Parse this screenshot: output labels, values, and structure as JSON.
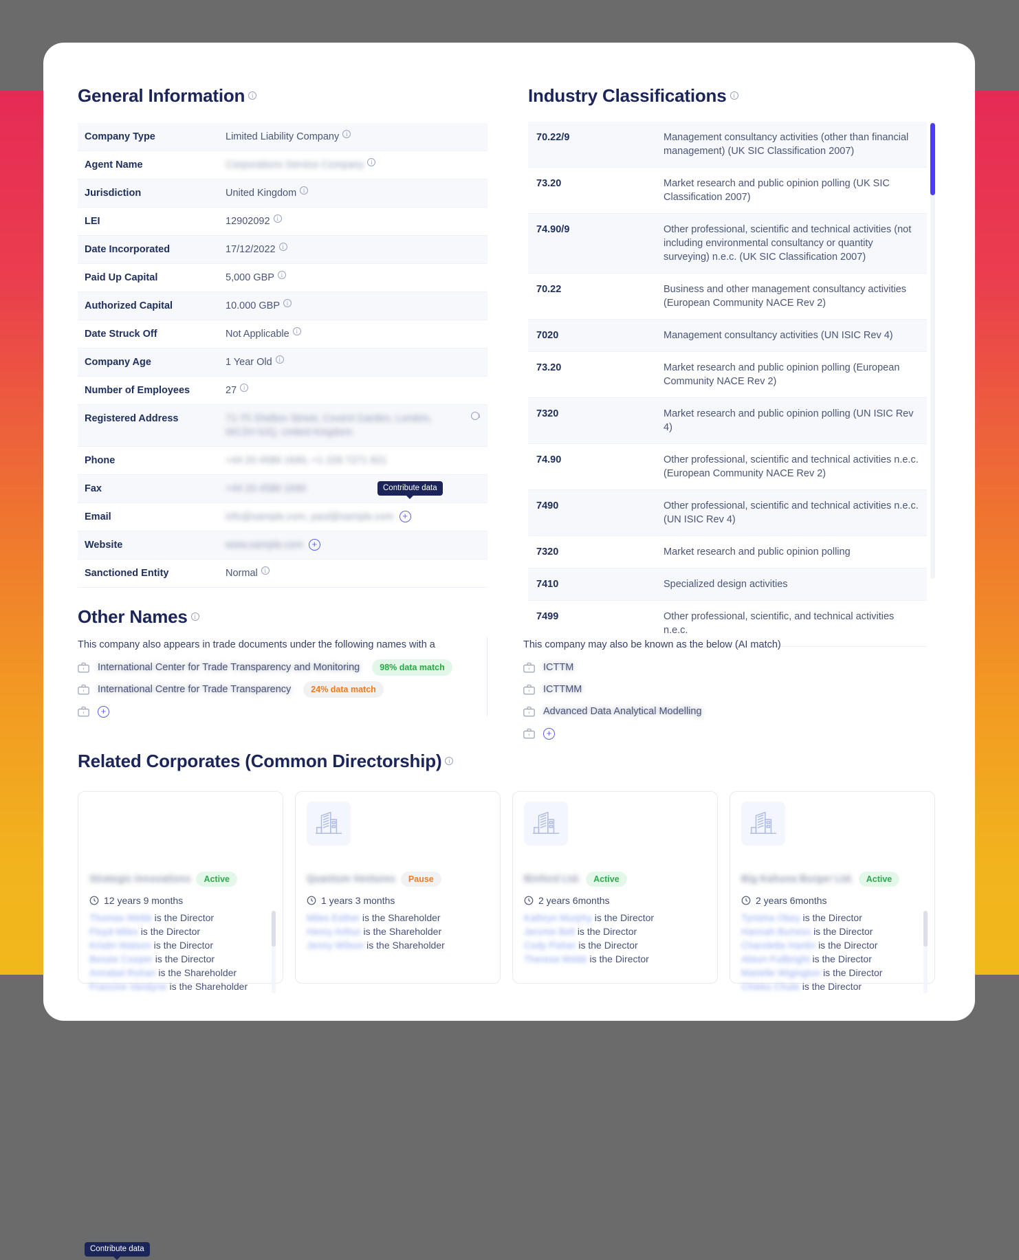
{
  "theme": {
    "accent": "#4b3df3",
    "title_color": "#1b2559",
    "gradient_top": "#e62a56",
    "gradient_bottom": "#f1b81c",
    "badge_green": "#28a745",
    "badge_orange": "#ec7a1c"
  },
  "general_information": {
    "title": "General Information",
    "rows": [
      {
        "label": "Company Type",
        "value": "Limited Liability Company",
        "redacted": false,
        "has_info": true
      },
      {
        "label": "Agent Name",
        "value": "Corporations Service Company",
        "redacted": true,
        "has_info": true
      },
      {
        "label": "Jurisdiction",
        "value": "United Kingdom",
        "redacted": false,
        "has_info": true
      },
      {
        "label": "LEI",
        "value": "12902092",
        "redacted": false,
        "has_info": true
      },
      {
        "label": "Date Incorporated",
        "value": "17/12/2022",
        "redacted": false,
        "has_info": true
      },
      {
        "label": "Paid Up Capital",
        "value": "5,000 GBP",
        "redacted": false,
        "has_info": true
      },
      {
        "label": "Authorized Capital",
        "value": "10.000 GBP",
        "redacted": false,
        "has_info": true
      },
      {
        "label": "Date Struck Off",
        "value": "Not Applicable",
        "redacted": false,
        "has_info": true
      },
      {
        "label": "Company Age",
        "value": "1 Year Old",
        "redacted": false,
        "has_info": true
      },
      {
        "label": "Number of Employees",
        "value": "27",
        "redacted": false,
        "has_info": true
      },
      {
        "label": "Registered Address",
        "value": "71-75 Shelton Street, Covent Garden, London, WC2H 9JQ, United Kingdom",
        "redacted": true,
        "has_info": true
      },
      {
        "label": "Phone",
        "value": "+44 20 4586 1690, +1 228 7271 821",
        "redacted": true,
        "has_info": false
      },
      {
        "label": "Fax",
        "value": "+44 20 4586 1690",
        "redacted": true,
        "has_info": false
      },
      {
        "label": "Email",
        "value": "info@sample.com, paul@sample.com",
        "redacted": true,
        "has_info": false,
        "has_plus": true
      },
      {
        "label": "Website",
        "value": "www.sample.com",
        "redacted": true,
        "has_info": false,
        "has_plus": true
      },
      {
        "label": "Sanctioned Entity",
        "value": "Normal",
        "redacted": false,
        "has_info": true
      }
    ]
  },
  "tooltips": {
    "contribute": "Contribute data"
  },
  "industry_classifications": {
    "title": "Industry Classifications",
    "rows": [
      {
        "code": "70.22/9",
        "description": "Management consultancy activities (other than financial management) (UK SIC Classification 2007)"
      },
      {
        "code": "73.20",
        "description": "Market research and public opinion polling (UK SIC Classification 2007)"
      },
      {
        "code": "74.90/9",
        "description": "Other professional, scientific and technical activities (not including environmental consultancy or quantity surveying) n.e.c. (UK SIC Classification 2007)"
      },
      {
        "code": "70.22",
        "description": "Business and other management consultancy activities (European Community NACE Rev 2)"
      },
      {
        "code": "7020",
        "description": "Management consultancy activities (UN ISIC Rev 4)"
      },
      {
        "code": "73.20",
        "description": "Market research and public opinion polling (European Community NACE Rev 2)"
      },
      {
        "code": "7320",
        "description": "Market research and public opinion polling (UN ISIC Rev 4)"
      },
      {
        "code": "74.90",
        "description": "Other professional, scientific and technical activities n.e.c. (European Community NACE Rev 2)"
      },
      {
        "code": "7490",
        "description": "Other professional, scientific and technical activities n.e.c. (UN ISIC Rev 4)"
      },
      {
        "code": "7320",
        "description": "Market research and public opinion polling"
      },
      {
        "code": "7410",
        "description": "Specialized design activities"
      },
      {
        "code": "7499",
        "description": "Other professional, scientific, and technical activities n.e.c."
      }
    ]
  },
  "other_names": {
    "title": "Other Names",
    "left_lead": "This company also appears in trade documents under the following names with a",
    "right_lead": "This company may also be known as the below (AI match)",
    "left_items": [
      {
        "name": "International Center for Trade Transparency and Monitoring",
        "match": "98% data match",
        "match_style": "green"
      },
      {
        "name": "International Centre for Trade Transparency",
        "match": "24% data match",
        "match_style": "orange"
      }
    ],
    "right_items": [
      {
        "name": "ICTTM"
      },
      {
        "name": "ICTTMM"
      },
      {
        "name": "Advanced Data Analytical Modelling"
      }
    ]
  },
  "related_corporates": {
    "title": "Related Corporates (Common Directorship)",
    "cards": [
      {
        "name": "Strategic Innovations",
        "status": "Active",
        "status_style": "active",
        "duration": "12 years 9 months",
        "has_logo": false,
        "has_scrollbar": true,
        "people": [
          {
            "name": "Thomas Webb",
            "role": "is the Director"
          },
          {
            "name": "Floyd Miles",
            "role": "is the Director"
          },
          {
            "name": "Kristin Watson",
            "role": "is the Director"
          },
          {
            "name": "Bessie Cooper",
            "role": "is the Director"
          },
          {
            "name": "Annabel Rohan",
            "role": "is the Shareholder"
          },
          {
            "name": "Francine Vandyne",
            "role": "is the Shareholder"
          }
        ]
      },
      {
        "name": "Quantum Ventures",
        "status": "Pause",
        "status_style": "pause",
        "duration": "1 years 3 months",
        "has_logo": true,
        "has_scrollbar": false,
        "people": [
          {
            "name": "Miles Esther",
            "role": "is the Shareholder"
          },
          {
            "name": "Henry Arthur",
            "role": "is the Shareholder"
          },
          {
            "name": "Jenny Wilson",
            "role": "is the Shareholder"
          }
        ]
      },
      {
        "name": "Binford Ltd.",
        "status": "Active",
        "status_style": "active",
        "duration": "2 years 6months",
        "has_logo": true,
        "has_scrollbar": false,
        "people": [
          {
            "name": "Kathryn Murphy",
            "role": "is the Director"
          },
          {
            "name": "Jerome Bell",
            "role": "is the Director"
          },
          {
            "name": "Cody Fisher",
            "role": "is the Director"
          },
          {
            "name": "Theresa Webb",
            "role": "is the Director"
          }
        ]
      },
      {
        "name": "Big Kahuna Burger Ltd.",
        "status": "Active",
        "status_style": "active",
        "duration": "2 years 6months",
        "has_logo": true,
        "has_scrollbar": true,
        "people": [
          {
            "name": "Tynisha Obey",
            "role": "is the Director"
          },
          {
            "name": "Hannah Burress",
            "role": "is the Director"
          },
          {
            "name": "Charolette Hanlin",
            "role": "is the Director"
          },
          {
            "name": "Alison Fullbright",
            "role": "is the Director"
          },
          {
            "name": "Marielle Wigington",
            "role": "is the Director"
          },
          {
            "name": "Chieko Chute",
            "role": "is the Director"
          }
        ]
      }
    ]
  }
}
